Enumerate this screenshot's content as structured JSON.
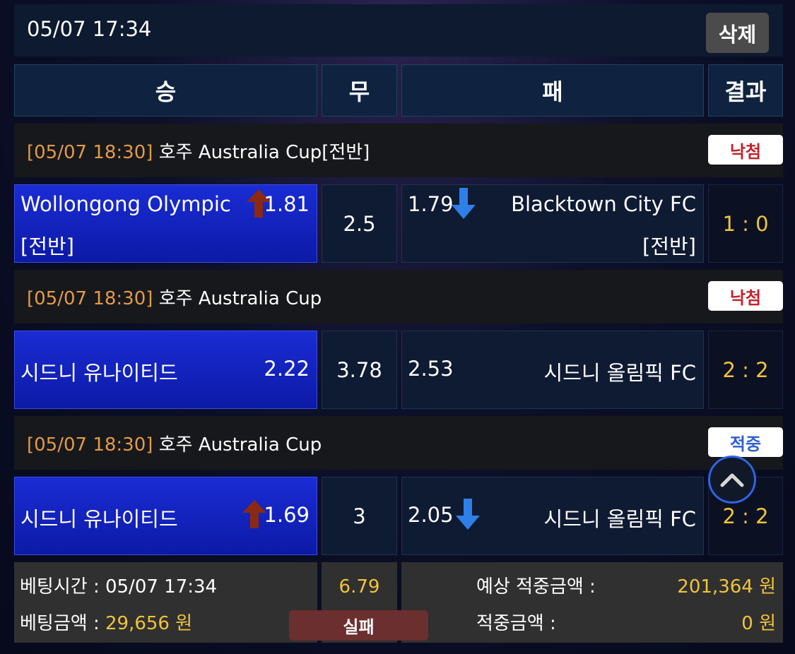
{
  "header": {
    "time": "05/07 17:34",
    "delete_label": "삭제"
  },
  "columns": {
    "win": "승",
    "draw": "무",
    "lose": "패",
    "result": "결과"
  },
  "matches": [
    {
      "date": "[05/07 18:30]",
      "league": "호주 Australia Cup[전반]",
      "badge": "낙첨",
      "home_team_line1": "Wollongong Olympic",
      "home_team_line2": "[전반]",
      "home_odd": "1.81",
      "home_arrow": "up",
      "draw_odd": "2.5",
      "away_odd": "1.79",
      "away_arrow": "down",
      "away_team_line1": "Blacktown City FC",
      "away_team_line2": "[전반]",
      "score": "1 : 0"
    },
    {
      "date": "[05/07 18:30]",
      "league": "호주 Australia Cup",
      "badge": "낙첨",
      "home_team_line1": "시드니 유나이티드",
      "home_odd": "2.22",
      "draw_odd": "3.78",
      "away_odd": "2.53",
      "away_team_line1": "시드니 올림픽 FC",
      "score": "2 : 2"
    },
    {
      "date": "[05/07 18:30]",
      "league": "호주 Australia Cup",
      "badge": "적중",
      "home_team_line1": "시드니 유나이티드",
      "home_odd": "1.69",
      "home_arrow": "up",
      "draw_odd": "3",
      "away_odd": "2.05",
      "away_arrow": "down",
      "away_team_line1": "시드니 올림픽 FC",
      "score": "2 : 2"
    }
  ],
  "footer": {
    "bet_time_label": "베팅시간 : 05/07 17:34",
    "bet_amount_label": "베팅금액 : ",
    "bet_amount_value": "29,656 원",
    "total_odd": "6.79",
    "status": "실패",
    "expected_label": "예상 적중금액 :",
    "expected_value": "201,364 원",
    "won_label": "적중금액 :",
    "won_value": "0 원"
  },
  "colors": {
    "odds_up": "#8a2a12",
    "odds_down": "#2f7fe8",
    "gold": "#f0c43a",
    "date_orange": "#e29a47",
    "lose_red": "#c0242b",
    "win_blue": "#2f5fd3"
  },
  "icons": {
    "up_arrow": "arrow-up-icon",
    "down_arrow": "arrow-down-icon",
    "scroll_top": "chevron-up-icon"
  }
}
